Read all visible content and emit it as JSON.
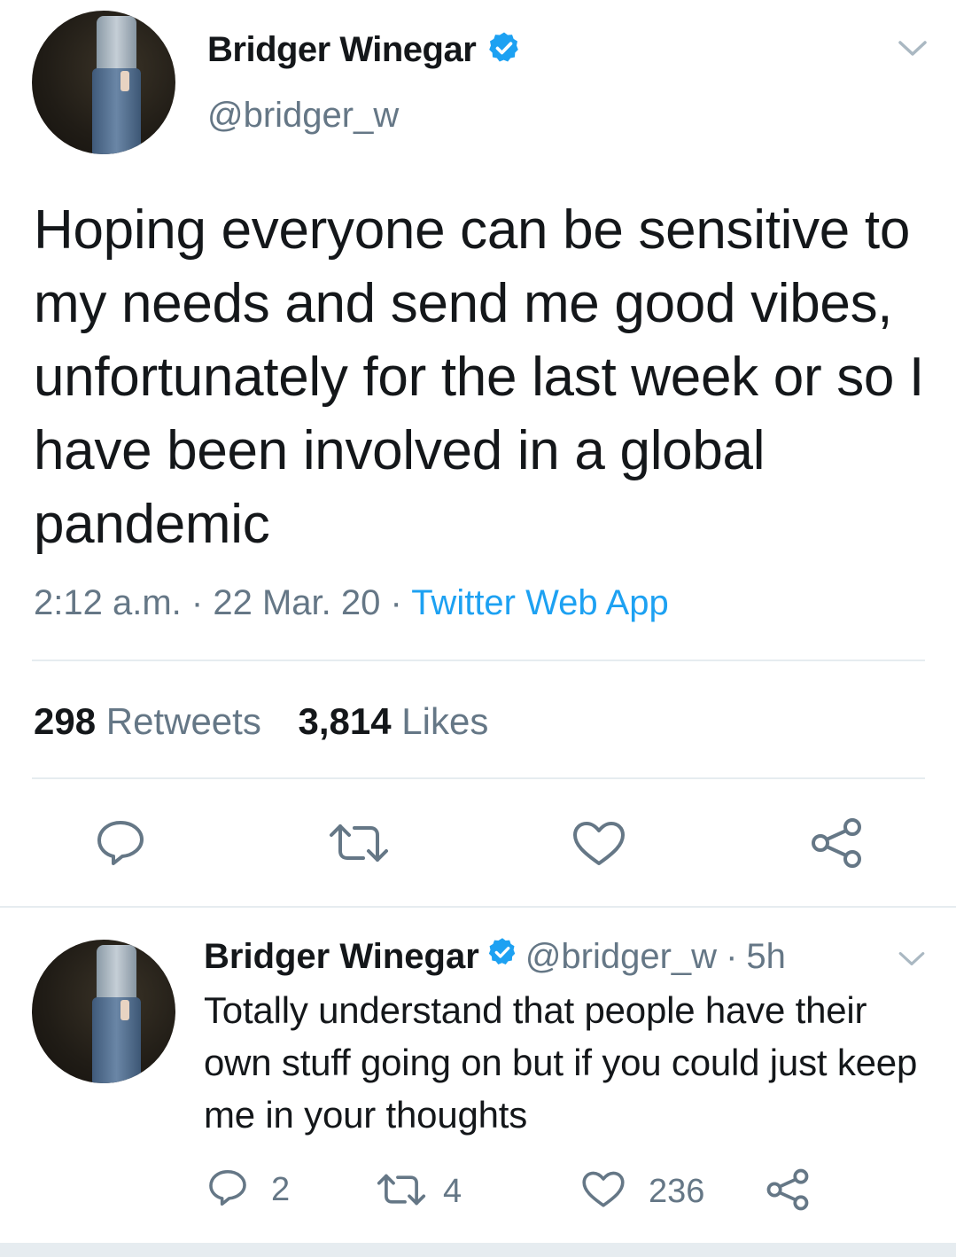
{
  "colors": {
    "accent": "#1da1f2",
    "text": "#14171a",
    "secondary": "#657786",
    "divider": "#e6ecf0"
  },
  "tweet": {
    "author_name": "Bridger Winegar",
    "author_handle": "@bridger_w",
    "text": "Hoping everyone can be sensitive to my needs and send me good vibes, unfortunately for the last week or so I have been involved in a global pandemic",
    "time": "2:12 a.m.",
    "sep1": "·",
    "date": "22 Mar. 20",
    "sep2": "·",
    "source": "Twitter Web App",
    "retweets_count": "298",
    "retweets_label": "Retweets",
    "likes_count": "3,814",
    "likes_label": "Likes",
    "icons": [
      "chevron-down-icon",
      "reply-icon",
      "retweet-icon",
      "like-icon",
      "share-icon",
      "verified-badge-icon"
    ]
  },
  "reply": {
    "author_name": "Bridger Winegar",
    "author_handle": "@bridger_w",
    "sep": "·",
    "age": "5h",
    "text": "Totally understand that people have their own stuff going on but if you could just keep me in your thoughts",
    "reply_count": "2",
    "retweet_count": "4",
    "like_count": "236"
  }
}
